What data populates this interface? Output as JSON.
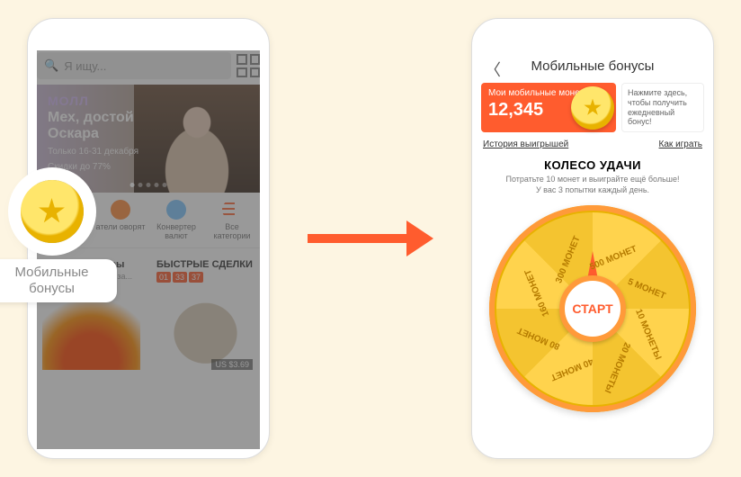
{
  "left": {
    "search_placeholder": "Я ищу...",
    "hero": {
      "brand": "МОЛЛ",
      "title": "Мех, достойный Оскара",
      "date": "Только 16-31 декабря",
      "discount": "Скидки до 77%"
    },
    "quick": {
      "buyers": "атели оворят",
      "converter": "Конвертер валют",
      "all": "Все категории"
    },
    "card1": {
      "title": "Горящие товары",
      "sub": "Самая низкая цена за..."
    },
    "card2": {
      "title": "БЫСТРЫЕ СДЕЛКИ",
      "t1": "01",
      "t2": "33",
      "t3": "37",
      "price": "US $3.69"
    },
    "callout": "Мобильные бонусы"
  },
  "right": {
    "title": "Мобильные бонусы",
    "balance_label": "Мои мобильные монеты:",
    "balance_value": "12,345",
    "tip": "Нажмите здесь, чтобы получить ежедневный бонус!",
    "history": "История выигрышей",
    "howto": "Как играть",
    "wheel_title": "КОЛЕСО УДАЧИ",
    "wheel_sub": "Потратьте 10 монет и выиграйте ещё больше!\nУ вас 3 попытки каждый день.",
    "start": "СТАРТ",
    "segments": [
      "5 МОНЕТ",
      "10 МОНЕТЫ",
      "20 МОНЕТЫ",
      "40 МОНЕТ",
      "80 МОНЕТ",
      "160 МОНЕТ",
      "300 МОНЕТ",
      "500 МОНЕТ"
    ]
  },
  "colors": {
    "accent": "#ff5c2e",
    "gold": "#ffd34d"
  }
}
